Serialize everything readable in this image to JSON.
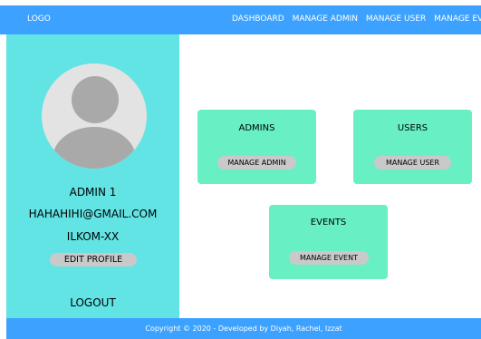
{
  "header": {
    "logo": "LOGO",
    "nav": [
      "DASHBOARD",
      "MANAGE ADMIN",
      "MANAGE USER",
      "MANAGE EVENT"
    ]
  },
  "sidebar": {
    "name": "ADMIN 1",
    "email": "HAHAHIHI@GMAIL.COM",
    "org": "ILKOM-XX",
    "edit_profile": "EDIT PROFILE",
    "logout": "LOGOUT"
  },
  "cards": {
    "admins": {
      "title": "ADMINS",
      "button": "MANAGE ADMIN"
    },
    "users": {
      "title": "USERS",
      "button": "MANAGE USER"
    },
    "events": {
      "title": "EVENTS",
      "button": "MANAGE EVENT"
    }
  },
  "footer": {
    "text": "Copyright © 2020 - Developed by Diyah, Rachel, Izzat"
  },
  "colors": {
    "header": "#3da2ff",
    "sidebar": "#62e3e4",
    "card": "#68f0c4",
    "button": "#c9c9c9"
  }
}
